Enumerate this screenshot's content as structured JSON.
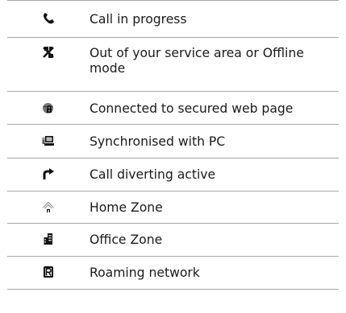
{
  "legend": {
    "rows": [
      {
        "icon": "phone-handset-icon",
        "text": "Call in progress"
      },
      {
        "icon": "no-service-icon",
        "text": "Out of your service area or Offline mode"
      },
      {
        "icon": "secure-lock-globe-icon",
        "text": "Connected to secured web page"
      },
      {
        "icon": "pc-sync-icon",
        "text": "Synchronised with PC"
      },
      {
        "icon": "call-divert-arrow-icon",
        "text": "Call diverting active"
      },
      {
        "icon": "home-zone-icon",
        "text": "Home Zone"
      },
      {
        "icon": "office-building-icon",
        "text": "Office Zone"
      },
      {
        "icon": "roaming-r-icon",
        "text": "Roaming network"
      }
    ]
  }
}
